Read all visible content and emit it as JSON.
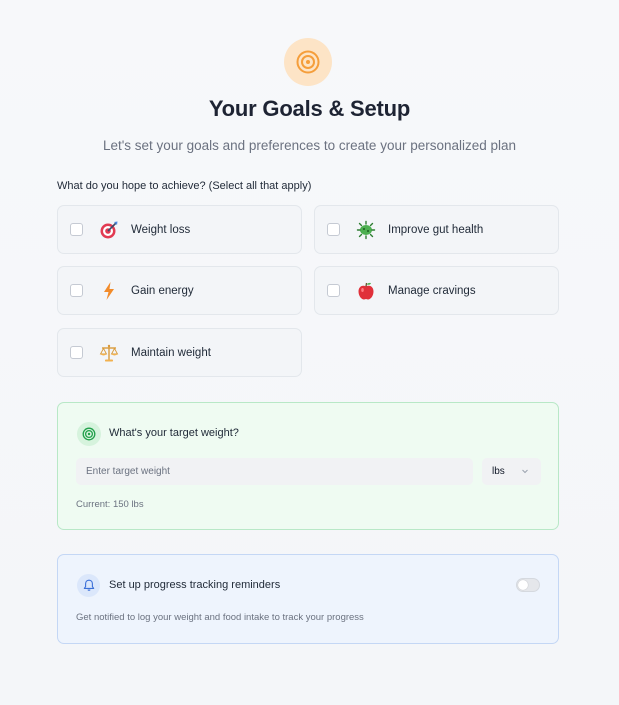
{
  "header": {
    "title": "Your Goals & Setup",
    "subtitle": "Let's set your goals and preferences to create your personalized plan",
    "icon": "target-icon",
    "icon_color": "#f59e3b"
  },
  "goals": {
    "question": "What do you hope to achieve? (Select all that apply)",
    "options": [
      {
        "label": "Weight loss",
        "icon": "dart-target-icon",
        "checked": false
      },
      {
        "label": "Improve gut health",
        "icon": "microbe-icon",
        "checked": false
      },
      {
        "label": "Gain energy",
        "icon": "lightning-icon",
        "checked": false
      },
      {
        "label": "Manage cravings",
        "icon": "apple-icon",
        "checked": false
      },
      {
        "label": "Maintain weight",
        "icon": "balance-scale-icon",
        "checked": false
      }
    ]
  },
  "target_weight": {
    "heading": "What's your target weight?",
    "placeholder": "Enter target weight",
    "value": "",
    "unit": "lbs",
    "current": "Current: 150 lbs",
    "accent": "#22a04b"
  },
  "reminders": {
    "heading": "Set up progress tracking reminders",
    "description": "Get notified to log your weight and food intake to track your progress",
    "enabled": false,
    "accent": "#3b6fd8"
  }
}
